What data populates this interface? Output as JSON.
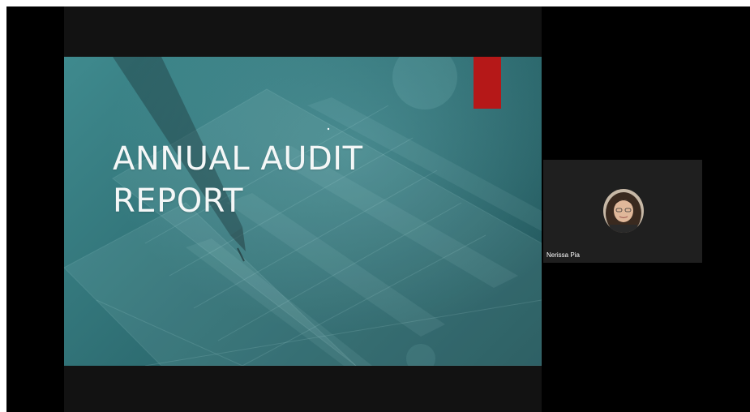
{
  "slide": {
    "title_line1": "ANNUAL AUDIT",
    "title_line2": "REPORT",
    "accent_color": "#b51818"
  },
  "participant": {
    "name": "Nerissa Pia"
  }
}
